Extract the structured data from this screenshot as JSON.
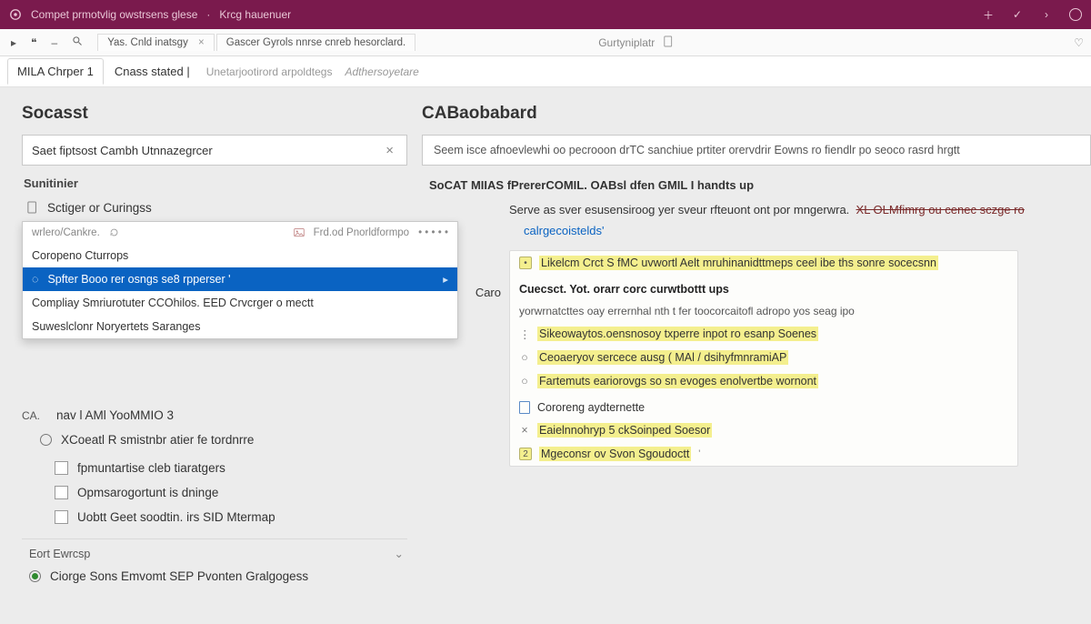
{
  "titlebar": {
    "app_icon": "app-logo",
    "title_left": "Compet prmotvlig owstrsens glese",
    "title_right": "Krcg hauenuer"
  },
  "toolbar": {
    "tab1": "Yas.  Cnld inatsgy",
    "tab2": "Gascer  Gyrols nnrse cnreb hesorclard.",
    "right_label": "Gurtyniplatr"
  },
  "ribbon": {
    "tab_a": "MILA  Chrper 1",
    "tab_b": "Cnass stated |",
    "hint_a": "Unetarjootirord arpoldtegs",
    "hint_b": "Adthersoyetare"
  },
  "left": {
    "heading": "Socasst",
    "search_value": "Saet fiptsost Cambh Utnnazegrcer",
    "section": "Sunitinier",
    "tree_item1": "Sctiger or Curingss",
    "dd_hint_left": "wrlero/Cankre.",
    "dd_hint_right": "Frd.od Pnorldformpo",
    "dd_item1": "Coropeno Cturrops",
    "dd_item_sel": "Spfter Booo rer osngs se8 rpperser '",
    "dd_item_sel_cat": "Caro",
    "dd_item3": "Compliay Smriurotuter CCOhilos. EED Crvcrger o mectt",
    "dd_item4": "Suweslclonr Noryertets Saranges",
    "cat_label": "CA.",
    "radio_label": "nav l AMl YooMMIO 3",
    "radio2_label": "XCoeatl  R smistnbr atier fe tordnrre",
    "chk1": "fpmuntartise cleb tiaratgers",
    "chk2": "Opmsarogortunt is dninge",
    "chk3": "Uobtt Geet soodtin. irs SID Mtermap",
    "group": "Eort Ewrcsp",
    "final": "Ciorge Sons Emvomt SEP Pvonten Gralgogess"
  },
  "right": {
    "heading": "CABaobabard",
    "desc": "Seem isce afnoevlewhi oo pecrooon drTC sanchiue prtiter orervdrir Eowns ro fiendlr po seoco rasrd hrgtt",
    "bold_line": "SoCAT MIIAS fPrererCOMIL. OABsl dfen GMIL I  handts up",
    "para": "Serve as sver esusensiroog yer sveur rfteuont ont por mngerwra.",
    "para_strike": "XL OLMfimrg ou cenec sczge ro",
    "blue": "calrgecoistelds'",
    "card_hi1": "Likelcm Crct S fMC uvwortl Aelt  mruhinanidttmeps   ceel ibe ths sonre socecsnn",
    "card_head": "Cuecsct. Yot. orarr corc curwtbottt ups",
    "card_sub": "yorwrnatcttes oay errernhal nth t  fer toocorcaitofl  adropo yos seag ipo",
    "card_b1": "Sikeowaytos.oensnosoy txperre inpot ro esanp Soenes",
    "card_b2": "Ceoaeryov sercece ausg ( MAl / dsihyfmnramiAP",
    "card_b3": "Fartemuts eariorovgs so sn evoges enolvertbe wornont",
    "card_doc": "Cororeng aydternette",
    "card_hi2": "Eaielnnohryp 5 ckSoinped Soesor",
    "card_hi3": "Mgeconsr ov Svon Sgoudoctt"
  }
}
